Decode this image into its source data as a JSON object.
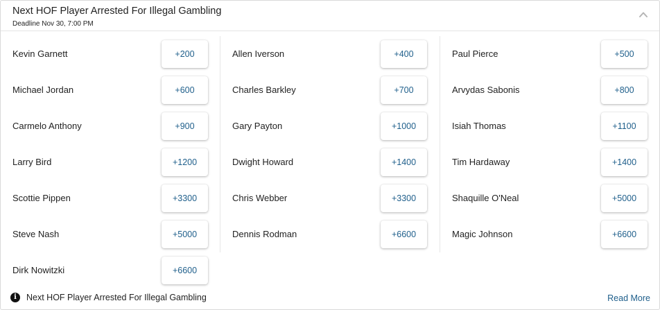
{
  "market": {
    "title": "Next HOF Player Arrested For Illegal Gambling",
    "deadline": "Deadline Nov 30, 7:00 PM"
  },
  "columns": [
    {
      "rows": [
        {
          "name": "Kevin Garnett",
          "odds": "+200"
        },
        {
          "name": "Michael Jordan",
          "odds": "+600"
        },
        {
          "name": "Carmelo Anthony",
          "odds": "+900"
        },
        {
          "name": "Larry Bird",
          "odds": "+1200"
        },
        {
          "name": "Scottie Pippen",
          "odds": "+3300"
        },
        {
          "name": "Steve Nash",
          "odds": "+5000"
        },
        {
          "name": "Dirk Nowitzki",
          "odds": "+6600"
        }
      ]
    },
    {
      "rows": [
        {
          "name": "Allen Iverson",
          "odds": "+400"
        },
        {
          "name": "Charles Barkley",
          "odds": "+700"
        },
        {
          "name": "Gary Payton",
          "odds": "+1000"
        },
        {
          "name": "Dwight Howard",
          "odds": "+1400"
        },
        {
          "name": "Chris Webber",
          "odds": "+3300"
        },
        {
          "name": "Dennis Rodman",
          "odds": "+6600"
        }
      ]
    },
    {
      "rows": [
        {
          "name": "Paul Pierce",
          "odds": "+500"
        },
        {
          "name": "Arvydas Sabonis",
          "odds": "+800"
        },
        {
          "name": "Isiah Thomas",
          "odds": "+1100"
        },
        {
          "name": "Tim Hardaway",
          "odds": "+1400"
        },
        {
          "name": "Shaquille O'Neal",
          "odds": "+5000"
        },
        {
          "name": "Magic Johnson",
          "odds": "+6600"
        }
      ]
    }
  ],
  "footer": {
    "icon": "info-icon",
    "text": "Next HOF Player Arrested For Illegal Gambling",
    "read_more": "Read More"
  },
  "colors": {
    "odds_text": "#1f5f8b",
    "link": "#1f5f8b"
  }
}
